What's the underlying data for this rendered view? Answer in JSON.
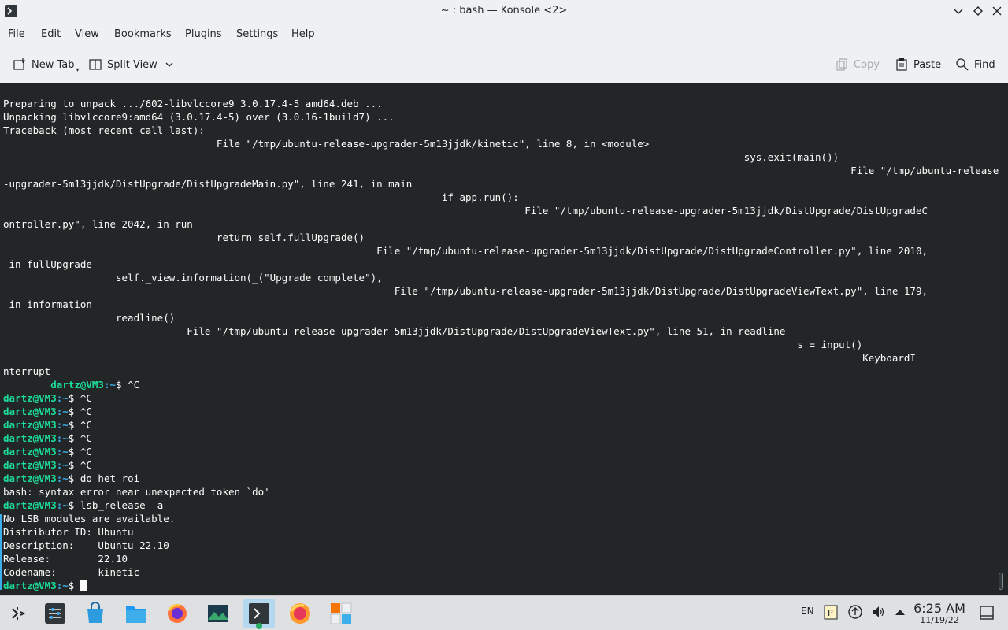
{
  "window": {
    "title": "~ : bash — Konsole <2>"
  },
  "menubar": {
    "items": [
      "File",
      "Edit",
      "View",
      "Bookmarks",
      "Plugins",
      "Settings",
      "Help"
    ]
  },
  "toolbar": {
    "new_tab": "New Tab",
    "split_view": "Split View",
    "copy": "Copy",
    "paste": "Paste",
    "find": "Find"
  },
  "terminal": {
    "lines": [
      "Preparing to unpack .../602-libvlccore9_3.0.17.4-5_amd64.deb ...",
      "Unpacking libvlccore9:amd64 (3.0.17.4-5) over (3.0.16-1build7) ...",
      "Traceback (most recent call last):",
      "                                    File \"/tmp/ubuntu-release-upgrader-5m13jjdk/kinetic\", line 8, in <module>",
      "                                                                                                                             sys.exit(main())",
      "                                                                                                                                               File \"/tmp/ubuntu-release",
      "-upgrader-5m13jjdk/DistUpgrade/DistUpgradeMain.py\", line 241, in main",
      "                                                                          if app.run():",
      "                                                                                        File \"/tmp/ubuntu-release-upgrader-5m13jjdk/DistUpgrade/DistUpgradeC",
      "ontroller.py\", line 2042, in run",
      "                                    return self.fullUpgrade()",
      "                                                               File \"/tmp/ubuntu-release-upgrader-5m13jjdk/DistUpgrade/DistUpgradeController.py\", line 2010,",
      " in fullUpgrade",
      "                   self._view.information(_(\"Upgrade complete\"),",
      "                                                                  File \"/tmp/ubuntu-release-upgrader-5m13jjdk/DistUpgrade/DistUpgradeViewText.py\", line 179,",
      " in information",
      "                   readline()",
      "                               File \"/tmp/ubuntu-release-upgrader-5m13jjdk/DistUpgrade/DistUpgradeViewText.py\", line 51, in readline",
      "                                                                                                                                      s = input()",
      "                                                                                                                                                 KeyboardI",
      "nterrupt"
    ],
    "prompt_user": "dartz@VM3",
    "prompt_path": ":~",
    "prompt_symbol": "$",
    "first_prompt_indent": "        ",
    "session": [
      {
        "type": "prompt",
        "cmd": "^C"
      },
      {
        "type": "prompt",
        "cmd": "^C"
      },
      {
        "type": "prompt",
        "cmd": "^C"
      },
      {
        "type": "prompt",
        "cmd": "^C"
      },
      {
        "type": "prompt",
        "cmd": "^C"
      },
      {
        "type": "prompt",
        "cmd": "^C"
      },
      {
        "type": "prompt",
        "cmd": "^C"
      },
      {
        "type": "prompt",
        "cmd": "do het roi"
      },
      {
        "type": "out",
        "text": "bash: syntax error near unexpected token `do'"
      },
      {
        "type": "prompt",
        "cmd": "lsb_release -a"
      },
      {
        "type": "out",
        "text": "No LSB modules are available."
      },
      {
        "type": "out",
        "text": "Distributor ID: Ubuntu"
      },
      {
        "type": "out",
        "text": "Description:    Ubuntu 22.10"
      },
      {
        "type": "out",
        "text": "Release:        22.10"
      },
      {
        "type": "out",
        "text": "Codename:       kinetic"
      },
      {
        "type": "prompt",
        "cmd": ""
      }
    ],
    "colors": {
      "background": "#232627",
      "text": "#fcfcfc",
      "prompt_user": "#1cdc9a",
      "prompt_path": "#3daee9"
    }
  },
  "taskbar": {
    "items": [
      "application-launcher-icon",
      "system-settings-icon",
      "discover-store-icon",
      "file-manager-icon",
      "firefox-icon",
      "image-viewer-icon",
      "konsole-icon",
      "firefox-alt-icon",
      "calculator-icon"
    ],
    "tray": {
      "language": "EN"
    },
    "clock": {
      "time": "6:25 AM",
      "date": "11/19/22"
    }
  }
}
